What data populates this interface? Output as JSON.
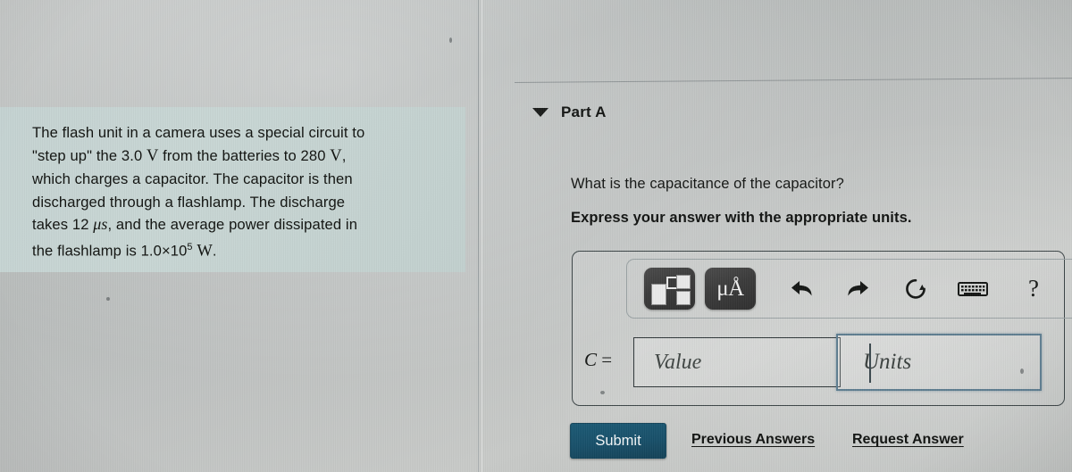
{
  "problem": {
    "text_line1": "The flash unit in a camera uses a special circuit to",
    "text_line2_a": "\"step up\" the 3.0 ",
    "text_line2_v": "V",
    "text_line2_b": " from the batteries to 280 ",
    "text_line2_v2": "V",
    "text_line2_c": ",",
    "text_line3": "which charges a capacitor. The capacitor is then",
    "text_line4": "discharged through a flashlamp. The discharge",
    "text_line5_a": "takes 12 ",
    "text_line5_mu": "μs",
    "text_line5_b": ", and the average power dissipated in",
    "text_line6_a": "the flashlamp is 1.0×10",
    "text_line6_exp": "5",
    "text_line6_b": " ",
    "text_line6_w": "W",
    "text_line6_c": ".",
    "full_text": "The flash unit in a camera uses a special circuit to \"step up\" the 3.0 V from the batteries to 280 V, which charges a capacitor. The capacitor is then discharged through a flashlamp. The discharge takes 12 μs, and the average power dissipated in the flashlamp is 1.0×10^5 W."
  },
  "part": {
    "collapse_icon": "caret-down-icon",
    "title": "Part A",
    "question": "What is the capacitance of the capacitor?",
    "instruction": "Express your answer with the appropriate units."
  },
  "toolbar": {
    "buttons": [
      {
        "name": "math-templates-button",
        "icon": "math-template-icon",
        "label": ""
      },
      {
        "name": "units-button",
        "icon": "micro-angstrom-icon",
        "label": "μÅ"
      },
      {
        "name": "undo-button",
        "icon": "undo-arrow-icon",
        "label": ""
      },
      {
        "name": "redo-button",
        "icon": "redo-arrow-icon",
        "label": ""
      },
      {
        "name": "reset-button",
        "icon": "reset-circular-arrow-icon",
        "label": ""
      },
      {
        "name": "keyboard-shortcuts-button",
        "icon": "keyboard-icon",
        "label": ""
      },
      {
        "name": "help-button",
        "icon": "question-mark-icon",
        "label": "?"
      }
    ],
    "help_glyph": "?",
    "units_glyph": "μÅ"
  },
  "answer": {
    "variable": "C",
    "equals": "=",
    "value_placeholder": "Value",
    "value_current": "",
    "units_placeholder": "Units",
    "units_current": "",
    "units_field_focused": true
  },
  "actions": {
    "submit_label": "Submit",
    "previous_answers_label": "Previous Answers",
    "request_answer_label": "Request Answer"
  },
  "colors": {
    "submit_button": "#17516e",
    "focus_border": "#5d7d90",
    "problem_panel": "#c5d3d2",
    "page_background": "#bcbfbe",
    "text": "#121412"
  }
}
